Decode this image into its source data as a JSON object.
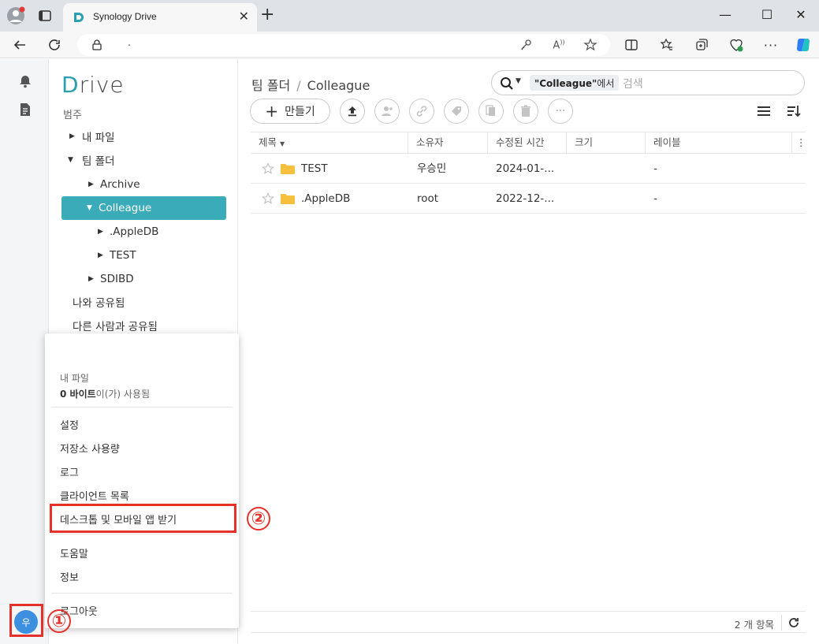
{
  "browser": {
    "tab_title": "Synology Drive",
    "url": ".",
    "window_controls": [
      "minimize",
      "maximize",
      "close"
    ]
  },
  "app": {
    "logo_prefix": "D",
    "logo_suffix": "rive",
    "section_label": "범주",
    "tree": [
      {
        "label": "내 파일",
        "expanded": false,
        "selected": false
      },
      {
        "label": "팀 폴더",
        "expanded": true,
        "selected": false
      },
      {
        "label": "Archive",
        "expanded": false,
        "selected": false
      },
      {
        "label": "Colleague",
        "expanded": true,
        "selected": true
      },
      {
        "label": ".AppleDB",
        "expanded": false,
        "selected": false
      },
      {
        "label": "TEST",
        "expanded": false,
        "selected": false
      },
      {
        "label": "SDIBD",
        "expanded": false,
        "selected": false
      }
    ],
    "shared_with_me": "나와 공유됨",
    "shared_with_others": "다른 사람과 공유됨",
    "accent_color": "#3aabb8"
  },
  "main": {
    "breadcrumb_root": "팀 폴더",
    "breadcrumb_sep": "/",
    "breadcrumb_current": "Colleague",
    "search_scope_name": "\"Colleague\"",
    "search_scope_suffix": "에서",
    "search_placeholder": "검색",
    "create_label": "만들기",
    "columns": [
      "제목",
      "소유자",
      "수정된 시간",
      "크기",
      "레이블"
    ],
    "rows": [
      {
        "name": "TEST",
        "owner": "우승민",
        "modified": "2024-01-...",
        "size": "",
        "label": "-"
      },
      {
        "name": ".AppleDB",
        "owner": "root",
        "modified": "2022-12-...",
        "size": "",
        "label": "-"
      }
    ],
    "item_count": "2 개 항목"
  },
  "user_menu": {
    "quota_title": "내 파일",
    "quota_amount": "0 바이트",
    "quota_suffix": "이(가) 사용됨",
    "items": [
      "설정",
      "저장소 사용량",
      "로그",
      "클라이언트 목록",
      "데스크톱 및 모바일 앱 받기",
      "도움말",
      "정보",
      "로그아웃"
    ]
  },
  "avatar_initial": "우",
  "annotations": {
    "step1": "①",
    "step2": "②",
    "color": "#e4322b"
  }
}
